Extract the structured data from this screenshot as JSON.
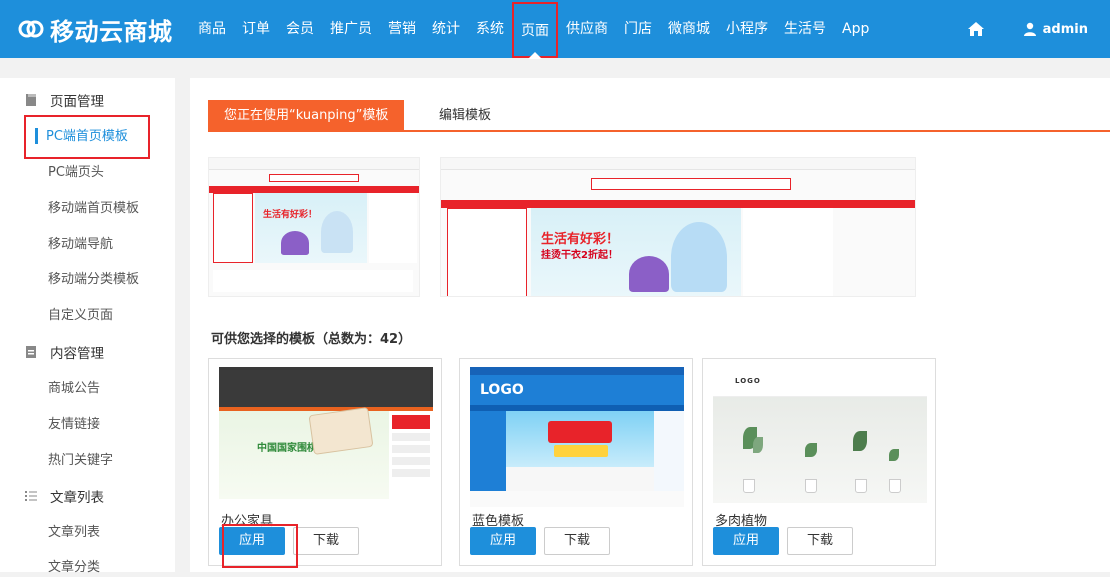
{
  "app": {
    "logo_text": "移动云商城"
  },
  "topnav": {
    "items": [
      "商品",
      "订单",
      "会员",
      "推广员",
      "营销",
      "统计",
      "系统",
      "页面",
      "供应商",
      "门店",
      "微商城",
      "小程序",
      "生活号",
      "App"
    ],
    "active": "页面",
    "user": "admin"
  },
  "sidebar": {
    "group1": "页面管理",
    "active_item": "PC端首页模板",
    "items1": [
      "PC端页头",
      "移动端首页模板",
      "移动端导航",
      "移动端分类模板",
      "自定义页面"
    ],
    "group2": "内容管理",
    "items2": [
      "商城公告",
      "友情链接",
      "热门关键字"
    ],
    "group3": "文章列表",
    "items3": [
      "文章列表",
      "文章分类"
    ]
  },
  "main": {
    "tab_active": "您正在使用“kuanping”模板",
    "tab_edit": "编辑模板",
    "preview_banner_text": "生活有好彩！",
    "preview_banner_sub": "挂烫干衣2折起！",
    "section_title": "可供您选择的模板（总数为：42）",
    "cards": [
      {
        "name": "办公家具",
        "apply": "应用",
        "download": "下载"
      },
      {
        "name": "蓝色模板",
        "apply": "应用",
        "download": "下载"
      },
      {
        "name": "多肉植物",
        "apply": "应用",
        "download": "下载"
      }
    ],
    "thumb1_text": "中国国家围棋队",
    "thumb2_logo": "LOGO",
    "thumb3_logo": "LOGO"
  },
  "colors": {
    "brand_blue": "#1e8fdb",
    "accent_orange": "#f5622c",
    "highlight_red": "#e8232a"
  }
}
